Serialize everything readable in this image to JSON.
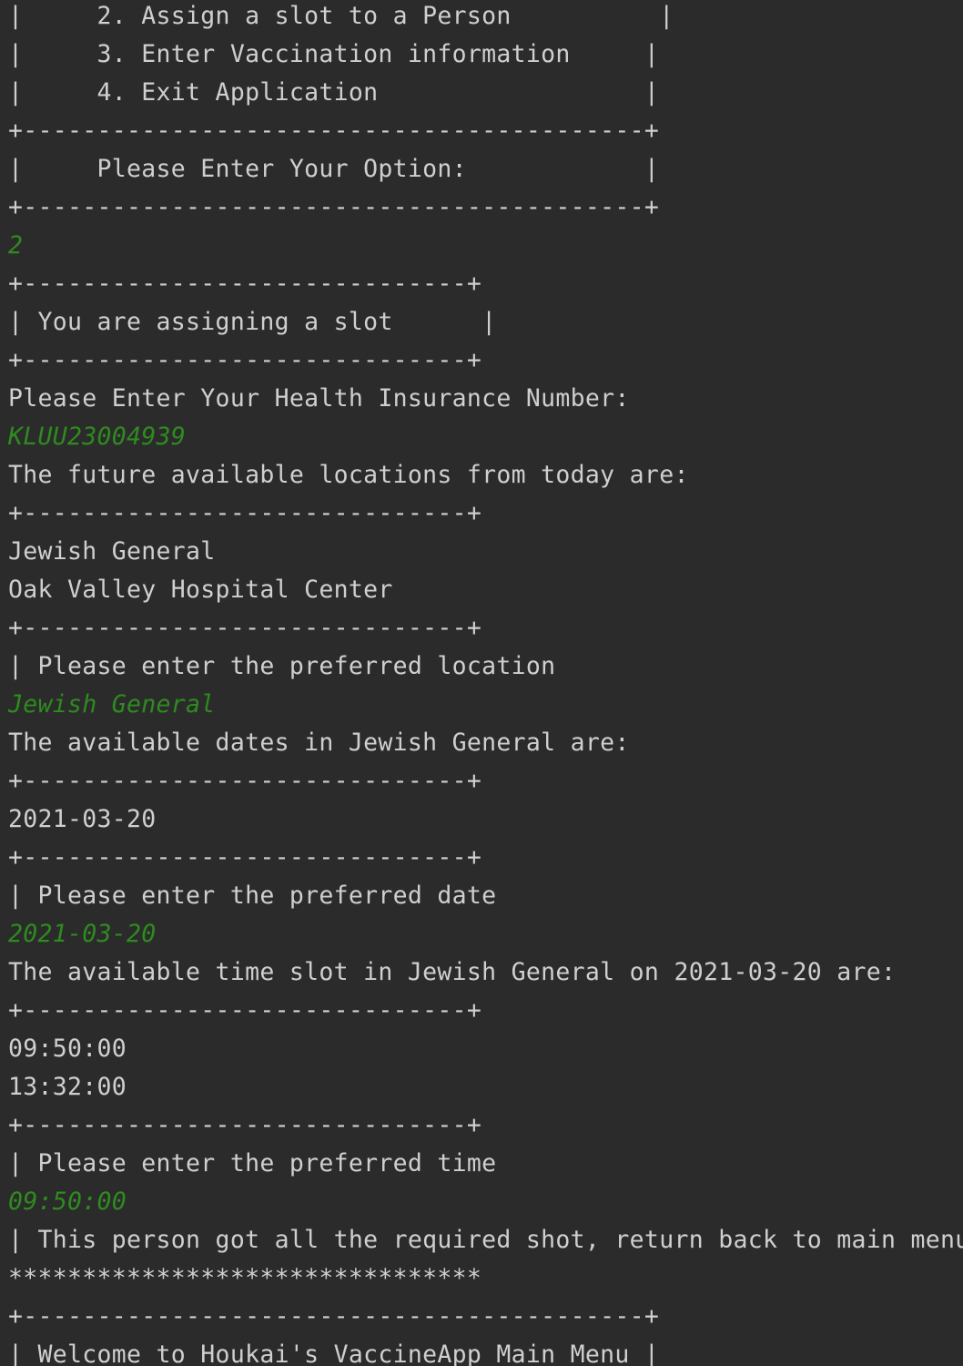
{
  "console": {
    "lines": [
      {
        "text": "|     2. Assign a slot to a Person          |",
        "kind": "output"
      },
      {
        "text": "|     3. Enter Vaccination information     |",
        "kind": "output"
      },
      {
        "text": "|     4. Exit Application                  |",
        "kind": "output"
      },
      {
        "text": "+------------------------------------------+",
        "kind": "output"
      },
      {
        "text": "|     Please Enter Your Option:            |",
        "kind": "output"
      },
      {
        "text": "+------------------------------------------+",
        "kind": "output"
      },
      {
        "text": "2",
        "kind": "input"
      },
      {
        "text": "+------------------------------+",
        "kind": "output"
      },
      {
        "text": "| You are assigning a slot      |",
        "kind": "output"
      },
      {
        "text": "+------------------------------+",
        "kind": "output"
      },
      {
        "text": "Please Enter Your Health Insurance Number:",
        "kind": "output"
      },
      {
        "text": "KLUU23004939",
        "kind": "input"
      },
      {
        "text": "The future available locations from today are:",
        "kind": "output"
      },
      {
        "text": "+------------------------------+",
        "kind": "output"
      },
      {
        "text": "Jewish General",
        "kind": "output"
      },
      {
        "text": "Oak Valley Hospital Center",
        "kind": "output"
      },
      {
        "text": "+------------------------------+",
        "kind": "output"
      },
      {
        "text": "| Please enter the preferred location",
        "kind": "output"
      },
      {
        "text": "Jewish General",
        "kind": "input"
      },
      {
        "text": "The available dates in Jewish General are:",
        "kind": "output"
      },
      {
        "text": "+------------------------------+",
        "kind": "output"
      },
      {
        "text": "2021-03-20",
        "kind": "output"
      },
      {
        "text": "+------------------------------+",
        "kind": "output"
      },
      {
        "text": "| Please enter the preferred date",
        "kind": "output"
      },
      {
        "text": "2021-03-20",
        "kind": "input"
      },
      {
        "text": "The available time slot in Jewish General on 2021-03-20 are:",
        "kind": "output"
      },
      {
        "text": "+------------------------------+",
        "kind": "output"
      },
      {
        "text": "09:50:00",
        "kind": "output"
      },
      {
        "text": "13:32:00",
        "kind": "output"
      },
      {
        "text": "+------------------------------+",
        "kind": "output"
      },
      {
        "text": "| Please enter the preferred time",
        "kind": "output"
      },
      {
        "text": "09:50:00",
        "kind": "input"
      },
      {
        "text": "| This person got all the required shot, return back to main menu",
        "kind": "output"
      },
      {
        "text": "********************************",
        "kind": "output"
      },
      {
        "text": "+------------------------------------------+",
        "kind": "output"
      },
      {
        "text": "| Welcome to Houkai's VaccineApp Main Menu |",
        "kind": "output"
      }
    ]
  },
  "colors": {
    "background": "#2b2b2b",
    "output_text": "#cfcfcf",
    "user_input_text": "#2e8b1f"
  }
}
